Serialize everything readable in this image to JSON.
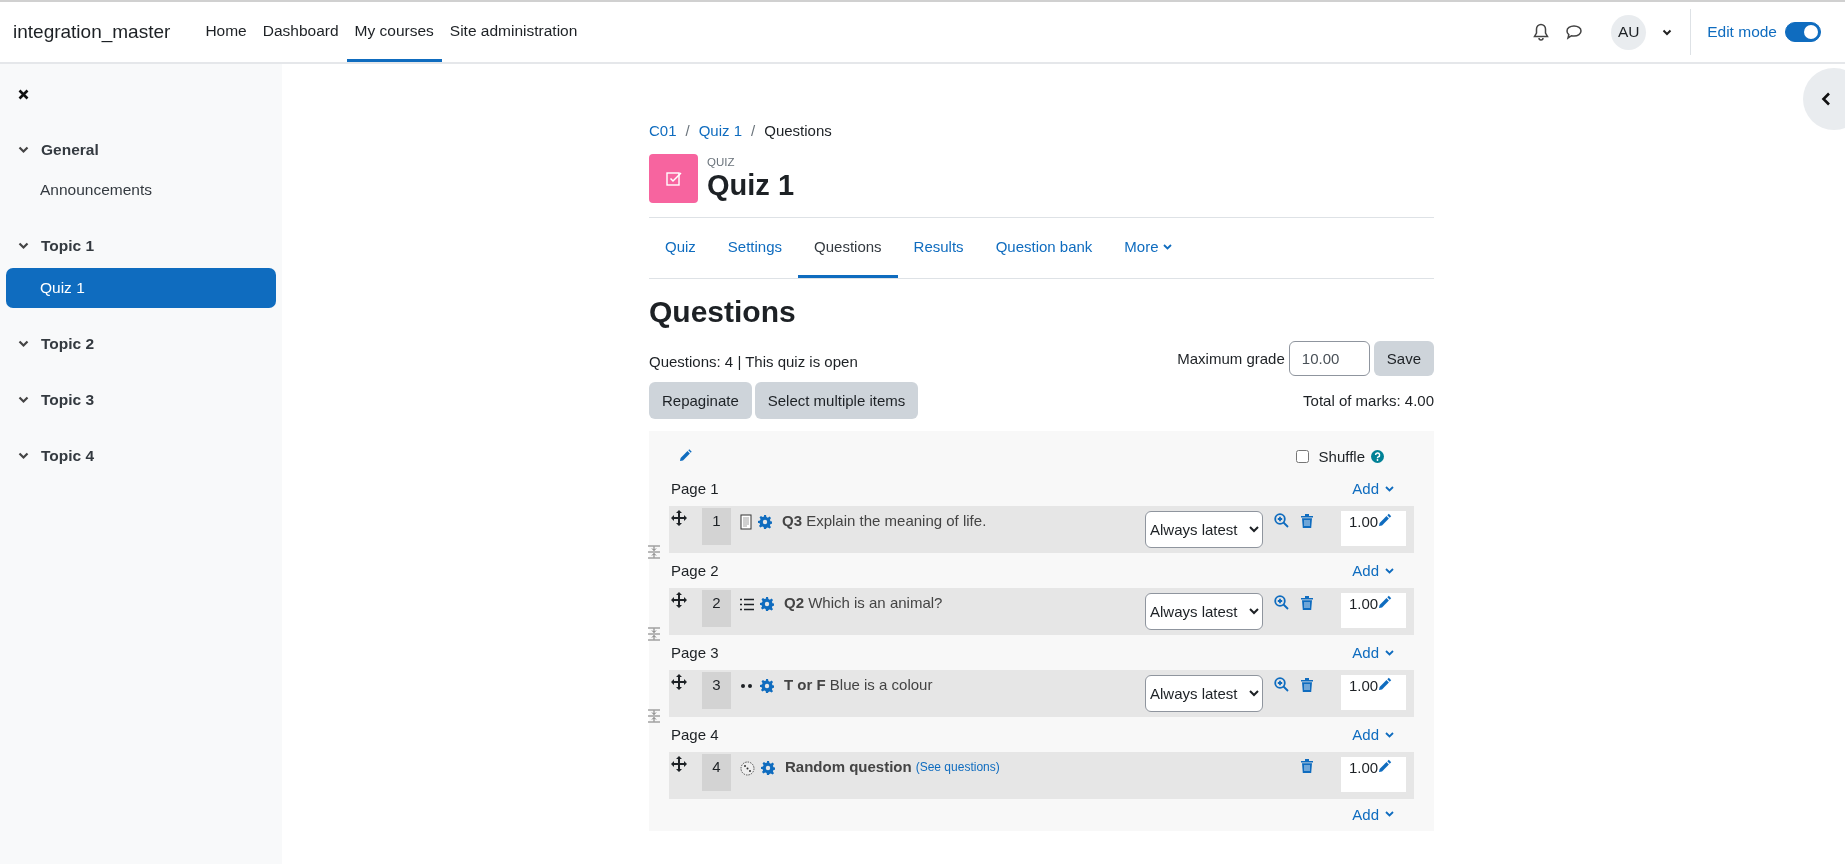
{
  "site_name": "integration_master",
  "nav": [
    {
      "label": "Home",
      "selected": false
    },
    {
      "label": "Dashboard",
      "selected": false
    },
    {
      "label": "My courses",
      "selected": true
    },
    {
      "label": "Site administration",
      "selected": false
    }
  ],
  "user": {
    "initials": "AU"
  },
  "edit_mode": {
    "label": "Edit mode",
    "on": true
  },
  "sidebar": {
    "sections": [
      {
        "title": "General",
        "expanded": true,
        "children": [
          {
            "label": "Announcements",
            "selected": false
          }
        ]
      },
      {
        "title": "Topic 1",
        "expanded": true,
        "children": [
          {
            "label": "Quiz 1",
            "selected": true
          }
        ]
      },
      {
        "title": "Topic 2",
        "expanded": true
      },
      {
        "title": "Topic 3",
        "expanded": true
      },
      {
        "title": "Topic 4",
        "expanded": true
      }
    ]
  },
  "breadcrumb": [
    {
      "label": "C01",
      "link": true
    },
    {
      "separator": "/",
      "label": "Quiz 1",
      "link": true
    },
    {
      "separator": "/",
      "label": "Questions",
      "link": false
    }
  ],
  "activity": {
    "type_label": "QUIZ",
    "title": "Quiz 1"
  },
  "tabs": [
    {
      "label": "Quiz",
      "selected": false,
      "kind": "link"
    },
    {
      "label": "Settings",
      "selected": false,
      "kind": "link"
    },
    {
      "label": "Questions",
      "selected": true,
      "kind": "link"
    },
    {
      "label": "Results",
      "selected": false,
      "kind": "link"
    },
    {
      "label": "Question bank",
      "selected": false,
      "kind": "link"
    },
    {
      "label": "More",
      "selected": false,
      "kind": "menu"
    }
  ],
  "heading": "Questions",
  "summary": "Questions: 4 | This quiz is open",
  "max_grade": {
    "label": "Maximum grade",
    "value": "10.00",
    "button": "Save"
  },
  "buttons": [
    "Repaginate",
    "Select multiple items"
  ],
  "total_marks": "Total of marks: 4.00",
  "shuffle": {
    "label": "Shuffle",
    "checked": false
  },
  "pages": [
    {
      "label": "Page 1",
      "add": "Add",
      "questions": [
        {
          "kind": "essay",
          "number": "1",
          "name": "Q3",
          "text": "Explain the meaning of life.",
          "version": "Always latest",
          "preview": true,
          "mark": "1.00"
        }
      ]
    },
    {
      "label": "Page 2",
      "add": "Add",
      "questions": [
        {
          "kind": "multichoice",
          "number": "2",
          "name": "Q2",
          "text": "Which is an animal?",
          "version": "Always latest",
          "preview": true,
          "mark": "1.00"
        }
      ]
    },
    {
      "label": "Page 3",
      "add": "Add",
      "questions": [
        {
          "kind": "truefalse",
          "number": "3",
          "name": "T or F",
          "text": "Blue is a colour",
          "version": "Always latest",
          "preview": true,
          "mark": "1.00"
        }
      ]
    },
    {
      "label": "Page 4",
      "add": "Add",
      "questions": [
        {
          "kind": "random",
          "number": "4",
          "name": "Random question",
          "link": "(See questions)",
          "preview": false,
          "mark": "1.00"
        }
      ]
    }
  ],
  "final_add": "Add"
}
